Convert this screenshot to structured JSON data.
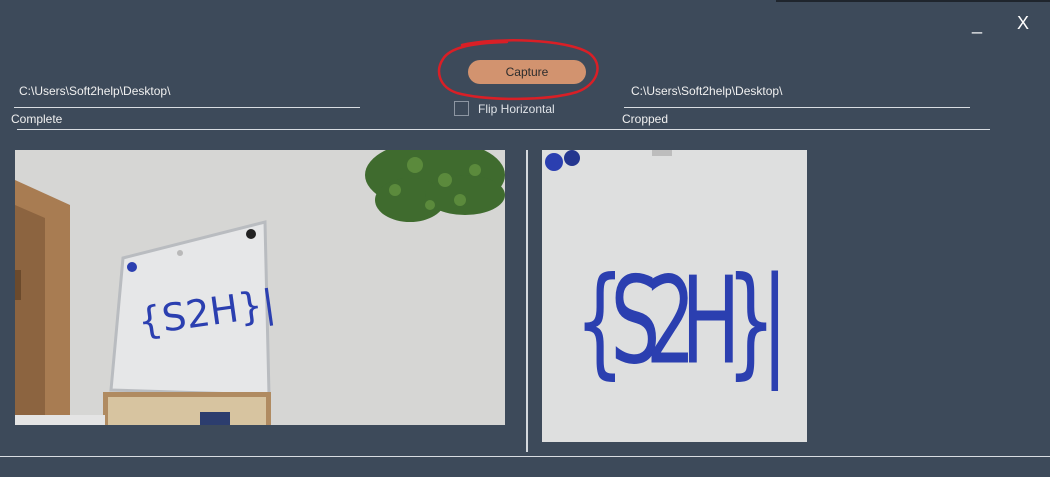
{
  "window": {
    "minimize_label": "_",
    "close_label": "X"
  },
  "toolbar": {
    "capture_label": "Capture",
    "flip_label": "Flip Horizontal",
    "flip_checked": false
  },
  "left": {
    "path_value": "C:\\Users\\Soft2help\\Desktop\\",
    "label": "Complete"
  },
  "right": {
    "path_value": "C:\\Users\\Soft2help\\Desktop\\",
    "label": "Cropped"
  },
  "colors": {
    "background": "#3d4a5a",
    "capture_button": "#d2936f",
    "annotation_circle": "#d91f26",
    "marker_ink": "#2b3fb0"
  },
  "whiteboard_text": "{S2H}"
}
